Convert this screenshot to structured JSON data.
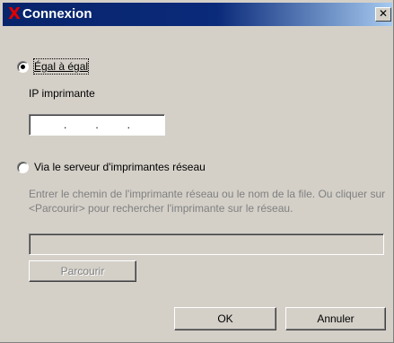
{
  "dialog": {
    "title": "Connexion",
    "close_symbol": "✕",
    "app_icon": "X"
  },
  "options": {
    "peer_to_peer": {
      "label": "Égal à égal",
      "selected": true,
      "ip_label": "IP imprimante",
      "ip_separators": [
        ".",
        ".",
        "."
      ]
    },
    "network_server": {
      "label": "Via le serveur d'imprimantes réseau",
      "selected": false,
      "description": "Entrer le chemin de l'imprimante réseau ou le nom de la file. Ou cliquer sur <Parcourir> pour rechercher l'imprimante sur le réseau.",
      "path_value": "",
      "browse_label": "Parcourir"
    }
  },
  "buttons": {
    "ok_label": "OK",
    "cancel_label": "Annuler"
  },
  "colors": {
    "title_bar": "#08246b",
    "dialog_bg": "#d4d0c8",
    "disabled_text": "#808080",
    "icon": "#e00000"
  }
}
